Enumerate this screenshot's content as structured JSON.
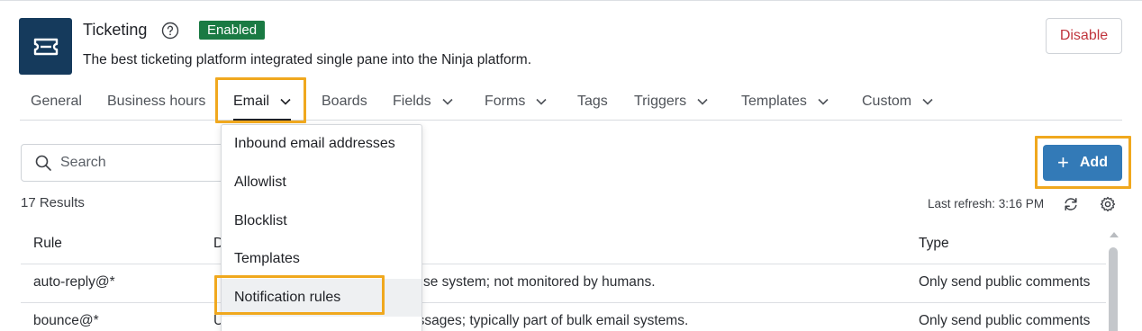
{
  "header": {
    "title": "Ticketing",
    "status_badge": "Enabled",
    "subtitle": "The best ticketing platform integrated single pane into the Ninja platform.",
    "disable_label": "Disable",
    "icon": "ticket-icon",
    "help_icon": "help-circle-icon"
  },
  "tabs": [
    {
      "label": "General"
    },
    {
      "label": "Business hours"
    },
    {
      "label": "Email"
    },
    {
      "label": "Boards"
    },
    {
      "label": "Fields"
    },
    {
      "label": "Forms"
    },
    {
      "label": "Tags"
    },
    {
      "label": "Triggers"
    },
    {
      "label": "Templates"
    },
    {
      "label": "Custom"
    }
  ],
  "email_menu": {
    "items": [
      {
        "label": "Inbound email addresses"
      },
      {
        "label": "Allowlist"
      },
      {
        "label": "Blocklist"
      },
      {
        "label": "Templates"
      },
      {
        "label": "Notification rules"
      }
    ]
  },
  "toolbar": {
    "search_placeholder": "Search",
    "add_label": "Add",
    "results_count": "17 Results",
    "last_refresh": "Last refresh: 3:16 PM"
  },
  "table": {
    "columns": [
      "Rule",
      "D",
      "Type"
    ],
    "rows": [
      {
        "rule": "auto-reply@*",
        "description": "se system; not monitored by humans.",
        "type": "Only send public comments"
      },
      {
        "rule": "bounce@*",
        "description": "Used to handle undeliverable messages; typically part of bulk email systems.",
        "type": "Only send public comments"
      }
    ]
  },
  "colors": {
    "brand_dark": "#153a5c",
    "enabled_green": "#1a7a43",
    "disable_red": "#c0353d",
    "primary_blue": "#337ab7",
    "highlight_orange": "#f0a81e"
  }
}
